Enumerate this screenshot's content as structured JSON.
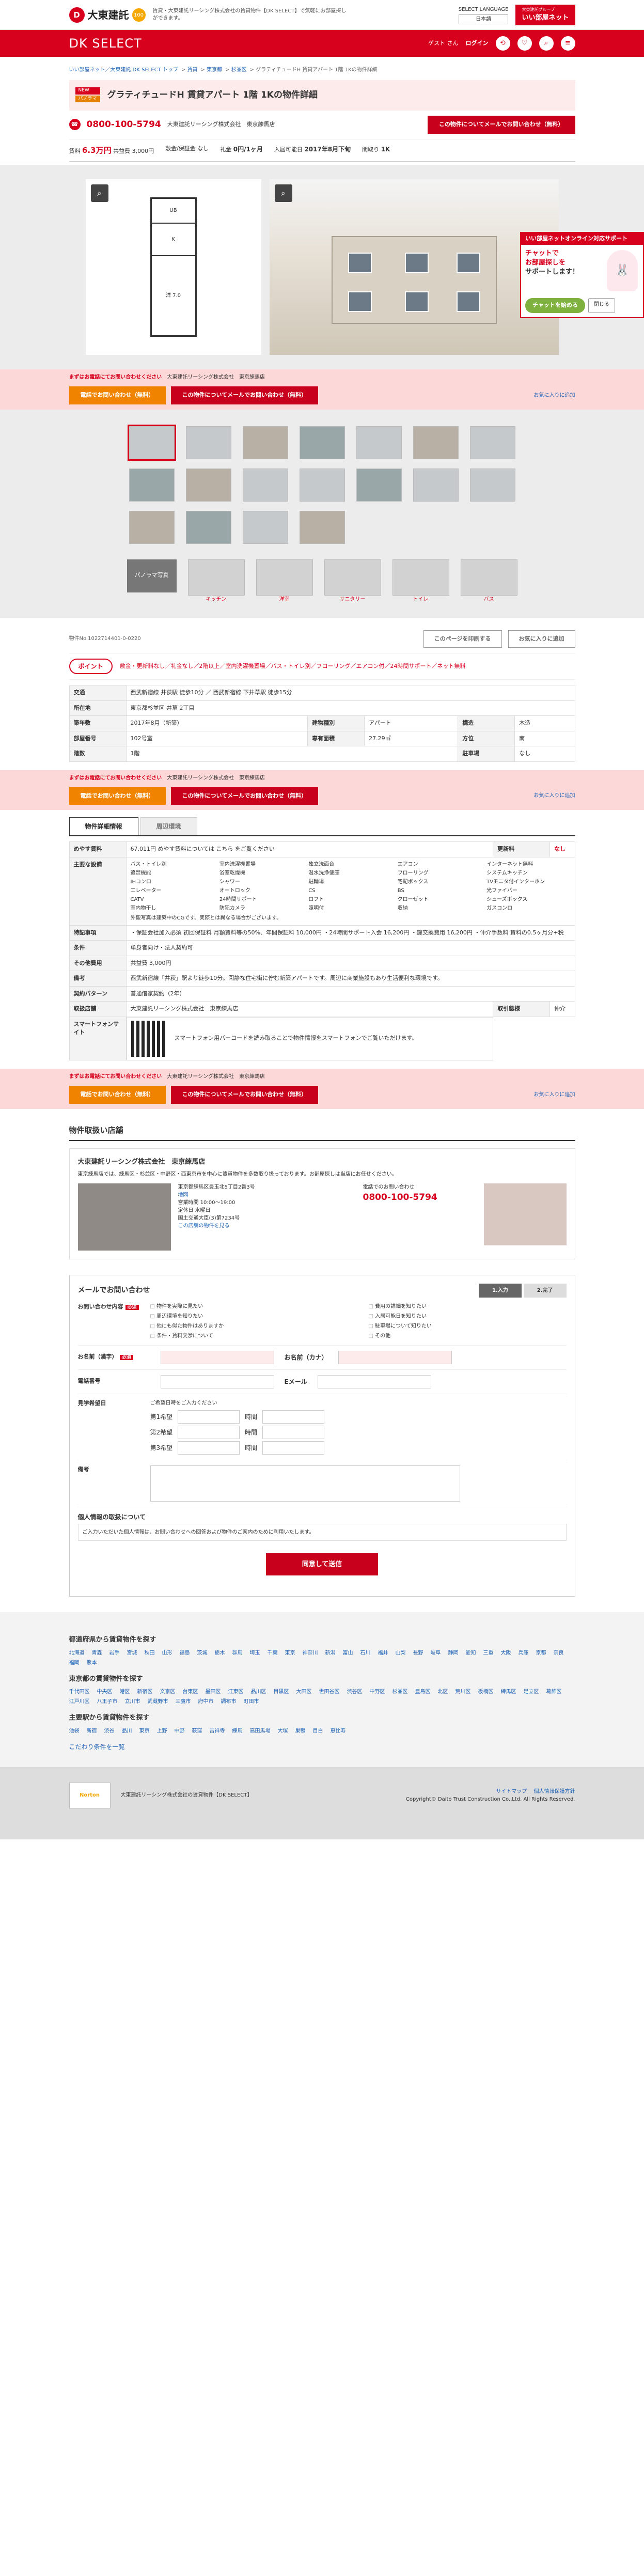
{
  "header": {
    "logo_text": "大東建託",
    "logo_badge": "100",
    "note": "賃貸・大東建託リーシング株式会社の賃貸物件【DK SELECT】で気軽にお部屋探しができます。",
    "lang_title": "SELECT LANGUAGE",
    "lang_value": "日本語",
    "partner_sub": "大東建託グループ",
    "partner_name": "いい部屋ネット"
  },
  "nav": {
    "brand": "DK SELECT",
    "guest": "ゲスト さん",
    "login": "ログイン",
    "icons": [
      "history-icon",
      "heart-icon",
      "search-icon",
      "menu-icon"
    ]
  },
  "breadcrumb": [
    "いい部屋ネット／大東建託 DK SELECT トップ",
    "賃貸",
    "東京都",
    "杉並区",
    "グラティチュードH 賃貸アパート 1階 1Kの物件詳細"
  ],
  "property": {
    "badge_new": "NEW",
    "badge_pano": "パノラマ",
    "title": "グラティチュードH 賃貸アパート 1階 1Kの物件詳細",
    "phone": "0800-100-5794",
    "shop": "大東建託リーシング株式会社　東京練馬店",
    "mail_button": "この物件についてメールでお問い合わせ（無料）",
    "rent_label": "賃料",
    "rent": "6.3万円",
    "mgmt": "共益費 3,000円",
    "deposit_label": "敷金/保証金",
    "deposit": "なし",
    "key_label": "礼金",
    "key_money": "0円/1ヶ月",
    "move_label": "入居可能日",
    "move": "2017年8月下旬",
    "layout_label": "間取り",
    "layout": "1K"
  },
  "gallery": {
    "floorplan_rooms": [
      "洋 7.0",
      "K",
      "UB"
    ],
    "panorama_tag": "パノラマ写真",
    "panorama_items": [
      "キッチン",
      "洋室",
      "サニタリー",
      "トイレ",
      "バス"
    ]
  },
  "sticky": {
    "note_lead": "まずはお電話にてお問い合わせください",
    "note_shop": "大東建託リーシング株式会社　東京練馬店",
    "call_button": "電話でお問い合わせ（無料）",
    "mail_button": "この物件についてメールでお問い合わせ（無料）",
    "favorite_link": "お気に入りに追加"
  },
  "sidebar_banner": {
    "head": "いい部屋ネットオンライン対応サポート",
    "line1": "チャットで",
    "line2": "お部屋探しを",
    "line3": "サポートします！",
    "go": "チャットを始める",
    "close": "閉じる"
  },
  "actions": {
    "code": "物件No.1022714401-0-0220",
    "print": "このページを印刷する",
    "favorite": "お気に入りに追加"
  },
  "point": {
    "tag": "ポイント",
    "text": "敷金・更新料なし／礼金なし／2階以上／室内洗濯機置場／バス・トイレ別／フローリング／エアコン付／24時間サポート／ネット無料"
  },
  "details": {
    "rows": [
      {
        "label": "交通",
        "value": "西武新宿線 井荻駅 徒歩10分 ／ 西武新宿線 下井草駅 徒歩15分"
      },
      {
        "label": "所在地",
        "value": "東京都杉並区 井草 2丁目"
      },
      {
        "label": "築年数",
        "value": "2017年8月（新築）"
      },
      {
        "label": "部屋番号",
        "value": "102号室"
      }
    ],
    "side": [
      {
        "label": "建物種別",
        "value": "アパート"
      },
      {
        "label": "構造",
        "value": "木造"
      },
      {
        "label": "専有面積",
        "value": "27.29㎡"
      },
      {
        "label": "方位",
        "value": "南"
      },
      {
        "label": "階数",
        "value": "1階"
      },
      {
        "label": "駐車場",
        "value": "なし"
      }
    ]
  },
  "tabs": {
    "info": "物件詳細情報",
    "area": "周辺環境"
  },
  "info": {
    "fee_label": "めやす賃料",
    "fee_value": "67,011円 めやす賃料については こちら をご覧ください",
    "renew_label": "更新料",
    "renew_value": "なし",
    "features_label": "主要な設備",
    "features": [
      "バス・トイレ別",
      "室内洗濯機置場",
      "独立洗面台",
      "エアコン",
      "インターネット無料",
      "追焚機能",
      "浴室乾燥機",
      "温水洗浄便座",
      "フローリング",
      "システムキッチン",
      "IHコンロ",
      "シャワー",
      "駐輪場",
      "宅配ボックス",
      "TVモニタ付インターホン",
      "エレベーター",
      "オートロック",
      "CS",
      "BS",
      "光ファイバー",
      "CATV",
      "24時間サポート",
      "ロフト",
      "クローゼット",
      "シューズボックス",
      "室内物干し",
      "防犯カメラ",
      "照明付",
      "収納",
      "ガスコンロ"
    ],
    "features_note": "外観写真は建築中のCGです。実際とは異なる場合がございます。",
    "special_label": "特記事項",
    "special_value": "・保証会社加入必須 初回保証料 月額賃料等の50%、年間保証料 10,000円 ・24時間サポート入会 16,200円 ・鍵交換費用 16,200円 ・仲介手数料 賃料の0.5ヶ月分+税",
    "cond_label": "条件",
    "cond_value": "単身者向け・法人契約可",
    "other_label": "その他費用",
    "other_value": "共益費 3,000円",
    "remarks_label": "備考",
    "remarks_value": "西武新宿線「井荻」駅より徒歩10分。閑静な住宅街に佇む新築アパートです。周辺に商業施設もあり生活便利な環境です。",
    "contract_label": "契約パターン",
    "contract_value": "普通借家契約（2年）",
    "handling_label": "取扱店舗",
    "handling_value": "大東建託リーシング株式会社　東京練馬店",
    "trade_label": "取引態様",
    "trade_value": "仲介",
    "phone_label": "スマートフォンサイト",
    "phone_value": "スマートフォン用バーコードを読み取ることで物件情報をスマートフォンでご覧いただけます。"
  },
  "shop": {
    "heading": "物件取扱い店舗",
    "name": "大東建託リーシング株式会社　東京練馬店",
    "desc": "東京練馬店では、練馬区・杉並区・中野区・西東京市を中心に賃貸物件を多数取り扱っております。お部屋探しは当店にお任せください。",
    "address": "東京都練馬区豊玉北5丁目2番3号",
    "map": "地図",
    "hours": "営業時間 10:00〜19:00",
    "holiday": "定休日 水曜日",
    "license": "国土交通大臣(3)第7234号",
    "call_lead": "電話でのお問い合わせ",
    "phone": "0800-100-5794",
    "more": "この店舗の物件を見る"
  },
  "form": {
    "title": "メールでお問い合わせ",
    "step1": "1.入力",
    "step2": "2.完了",
    "req": "必須",
    "content_label": "お問い合わせ内容",
    "checks": [
      "物件を実際に見たい",
      "費用の詳細を知りたい",
      "周辺環境を知りたい",
      "入居可能日を知りたい",
      "他にも似た物件はありますか",
      "駐車場について知りたい",
      "条件・賃料交渉について",
      "その他"
    ],
    "name_label": "お名前（漢字）",
    "kana_label": "お名前（カナ）",
    "tel_label": "電話番号",
    "email_label": "Eメール",
    "visit_label": "見学希望日",
    "visit_note": "ご希望日時をご入力ください",
    "slots": [
      "第1希望",
      "第2希望",
      "第3希望"
    ],
    "time_label": "時間",
    "notes_label": "備考",
    "privacy_title": "個人情報の取扱について",
    "privacy_text": "ご入力いただいた個人情報は、お問い合わせへの回答および物件のご案内のために利用いたします。",
    "submit": "同意して送信"
  },
  "search": {
    "title1": "都道府県から賃貸物件を探す",
    "prefs": [
      "北海道",
      "青森",
      "岩手",
      "宮城",
      "秋田",
      "山形",
      "福島",
      "茨城",
      "栃木",
      "群馬",
      "埼玉",
      "千葉",
      "東京",
      "神奈川",
      "新潟",
      "富山",
      "石川",
      "福井",
      "山梨",
      "長野",
      "岐阜",
      "静岡",
      "愛知",
      "三重",
      "大阪",
      "兵庫",
      "京都",
      "奈良",
      "福岡",
      "熊本"
    ],
    "title2": "東京都の賃貸物件を探す",
    "wards": [
      "千代田区",
      "中央区",
      "港区",
      "新宿区",
      "文京区",
      "台東区",
      "墨田区",
      "江東区",
      "品川区",
      "目黒区",
      "大田区",
      "世田谷区",
      "渋谷区",
      "中野区",
      "杉並区",
      "豊島区",
      "北区",
      "荒川区",
      "板橋区",
      "練馬区",
      "足立区",
      "葛飾区",
      "江戸川区",
      "八王子市",
      "立川市",
      "武蔵野市",
      "三鷹市",
      "府中市",
      "調布市",
      "町田市"
    ],
    "title3": "主要駅から賃貸物件を探す",
    "stations": [
      "池袋",
      "新宿",
      "渋谷",
      "品川",
      "東京",
      "上野",
      "中野",
      "荻窪",
      "吉祥寺",
      "練馬",
      "高田馬場",
      "大塚",
      "巣鴨",
      "目白",
      "恵比寿"
    ],
    "more": "こだわり条件を一覧"
  },
  "footer": {
    "norton": "Norton",
    "text": "大東建託リーシング株式会社の賃貸物件【DK SELECT】",
    "sitemap": "サイトマップ",
    "privacy": "個人情報保護方針",
    "copyright": "Copyright© Daito Trust Construction Co.,Ltd. All Rights Reserved."
  },
  "colors": {
    "brand": "#d7001d",
    "accent": "#f08300",
    "chat": "#7fb13e"
  }
}
